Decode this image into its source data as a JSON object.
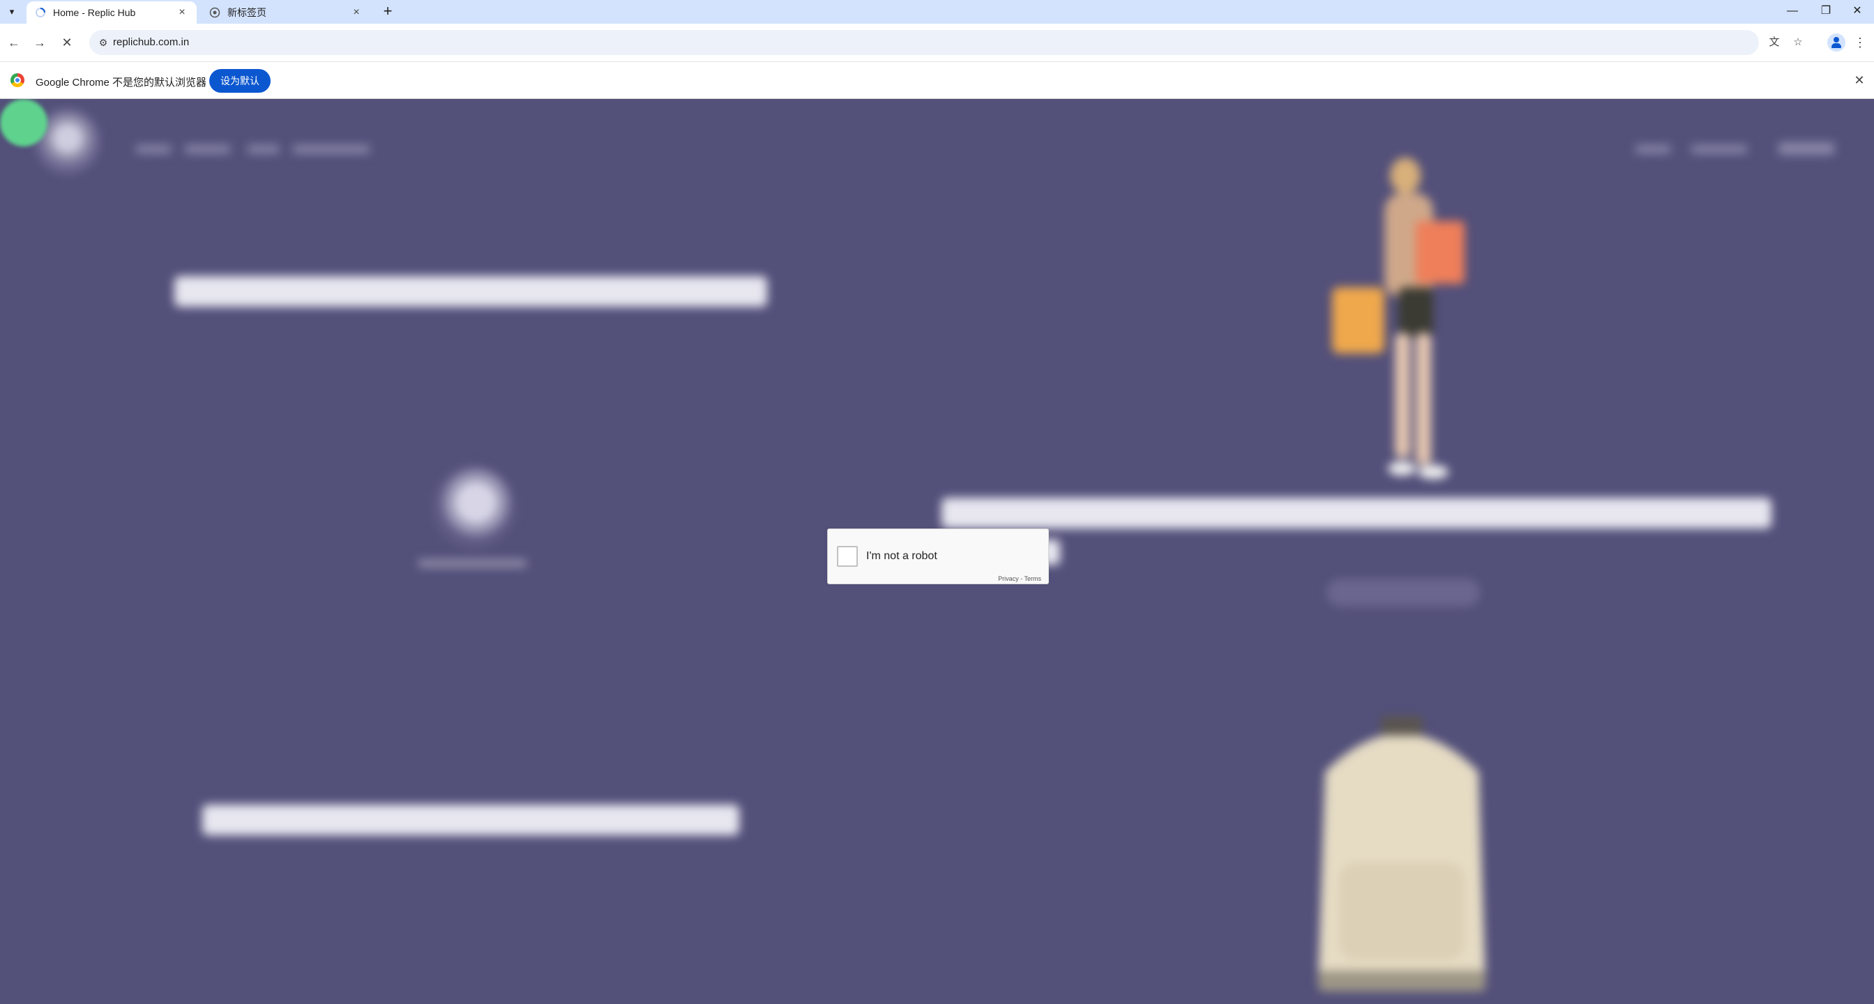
{
  "browser": {
    "tabs": [
      {
        "title": "Home - Replic Hub",
        "active": true
      },
      {
        "title": "新标签页",
        "active": false
      }
    ],
    "url": "replichub.com.in",
    "infobar": {
      "message": "Google Chrome 不是您的默认浏览器",
      "button": "设为默认"
    },
    "icons": {
      "tab_search": "▾",
      "tab_close": "×",
      "new_tab": "+",
      "minimize": "—",
      "restore": "❐",
      "close": "✕",
      "back": "←",
      "forward": "→",
      "stop": "✕",
      "site_info": "⚙",
      "translate": "文",
      "bookmark": "☆",
      "menu": "⋮",
      "infobar_close": "✕"
    }
  },
  "page": {
    "recaptcha": {
      "label": "I'm not a robot",
      "links": "Privacy - Terms"
    }
  }
}
